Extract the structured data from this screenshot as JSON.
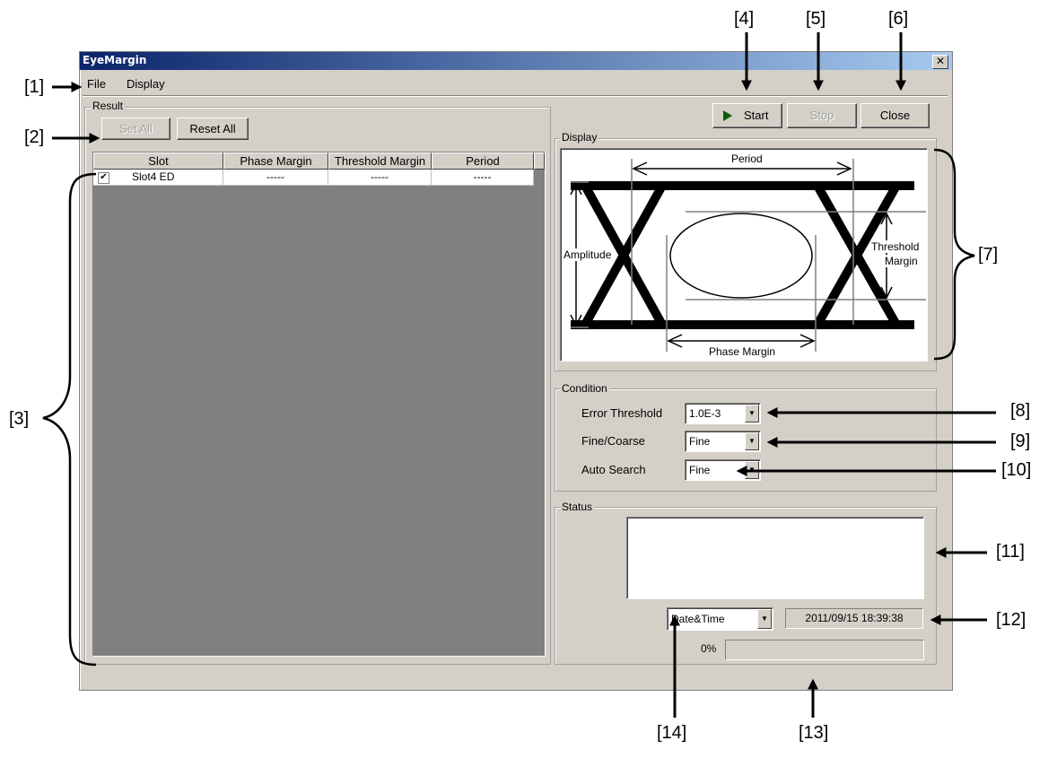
{
  "window": {
    "title": "EyeMargin",
    "close_glyph": "✕"
  },
  "menu": {
    "items": [
      "File",
      "Display"
    ]
  },
  "result": {
    "group_label": "Result",
    "set_all_label": "Set All",
    "reset_all_label": "Reset All",
    "table": {
      "columns": [
        "Slot",
        "Phase Margin",
        "Threshold Margin",
        "Period"
      ],
      "rows": [
        {
          "checked": true,
          "check_glyph": "✔",
          "slot": "Slot4 ED",
          "phase_margin": "-----",
          "threshold_margin": "-----",
          "period": "-----"
        }
      ]
    }
  },
  "toolbar": {
    "start_label": "Start",
    "stop_label": "Stop",
    "close_label": "Close",
    "play_icon": "play-icon"
  },
  "display": {
    "group_label": "Display",
    "diagram": {
      "period": "Period",
      "amplitude": "Amplitude",
      "threshold_line1": "Threshold",
      "threshold_line2": "Margin",
      "phase_margin": "Phase Margin"
    }
  },
  "condition": {
    "group_label": "Condition",
    "error_threshold_label": "Error Threshold",
    "error_threshold_value": "1.0E-3",
    "fine_coarse_label": "Fine/Coarse",
    "fine_coarse_value": "Fine",
    "auto_search_label": "Auto Search",
    "auto_search_value": "Fine"
  },
  "status": {
    "group_label": "Status",
    "message": "",
    "time_format_value": "Date&Time",
    "timestamp": "2011/09/15 18:39:38",
    "progress_text": "0%",
    "progress_fraction": 0
  },
  "callouts": [
    "[1]",
    "[2]",
    "[3]",
    "[4]",
    "[5]",
    "[6]",
    "[7]",
    "[8]",
    "[9]",
    "[10]",
    "[11]",
    "[12]",
    "[13]",
    "[14]"
  ],
  "colors": {
    "window_bg": "#d4d0c8",
    "title_start": "#0a246a",
    "title_end": "#a6caf0",
    "play_icon": "#0e5a0e",
    "table_bg": "#808080"
  }
}
